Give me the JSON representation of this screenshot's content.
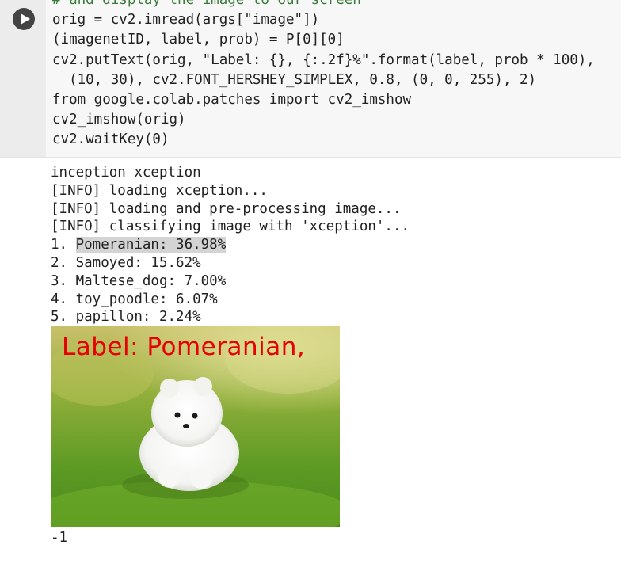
{
  "cell": {
    "run_label": "Run cell",
    "code_lines": [
      "# and display the image to our screen",
      "orig = cv2.imread(args[\"image\"])",
      "(imagenetID, label, prob) = P[0][0]",
      "cv2.putText(orig, \"Label: {}, {:.2f}%\".format(label, prob * 100),",
      "  (10, 30), cv2.FONT_HERSHEY_SIMPLEX, 0.8, (0, 0, 255), 2)",
      "from google.colab.patches import cv2_imshow",
      "cv2_imshow(orig)",
      "cv2.waitKey(0)"
    ]
  },
  "output": {
    "lines": [
      "inception xception",
      "[INFO] loading xception...",
      "[INFO] loading and pre-processing image...",
      "[INFO] classifying image with 'xception'..."
    ],
    "predictions": [
      {
        "prefix": "1. ",
        "text": "Pomeranian: 36.98%"
      },
      {
        "prefix": "2. ",
        "text": "Samoyed: 15.62%"
      },
      {
        "prefix": "3. ",
        "text": "Maltese_dog: 7.00%"
      },
      {
        "prefix": "4. ",
        "text": "toy_poodle: 6.07%"
      },
      {
        "prefix": "5. ",
        "text": "papillon: 2.24%"
      }
    ],
    "image_overlay_text": "Label: Pomeranian,",
    "return_value": "-1"
  },
  "colors": {
    "keyword": "#a626a4",
    "string": "#c41a16",
    "number": "#098658",
    "overlay_text": "#e60000"
  },
  "icons": {
    "run": "play-icon"
  }
}
